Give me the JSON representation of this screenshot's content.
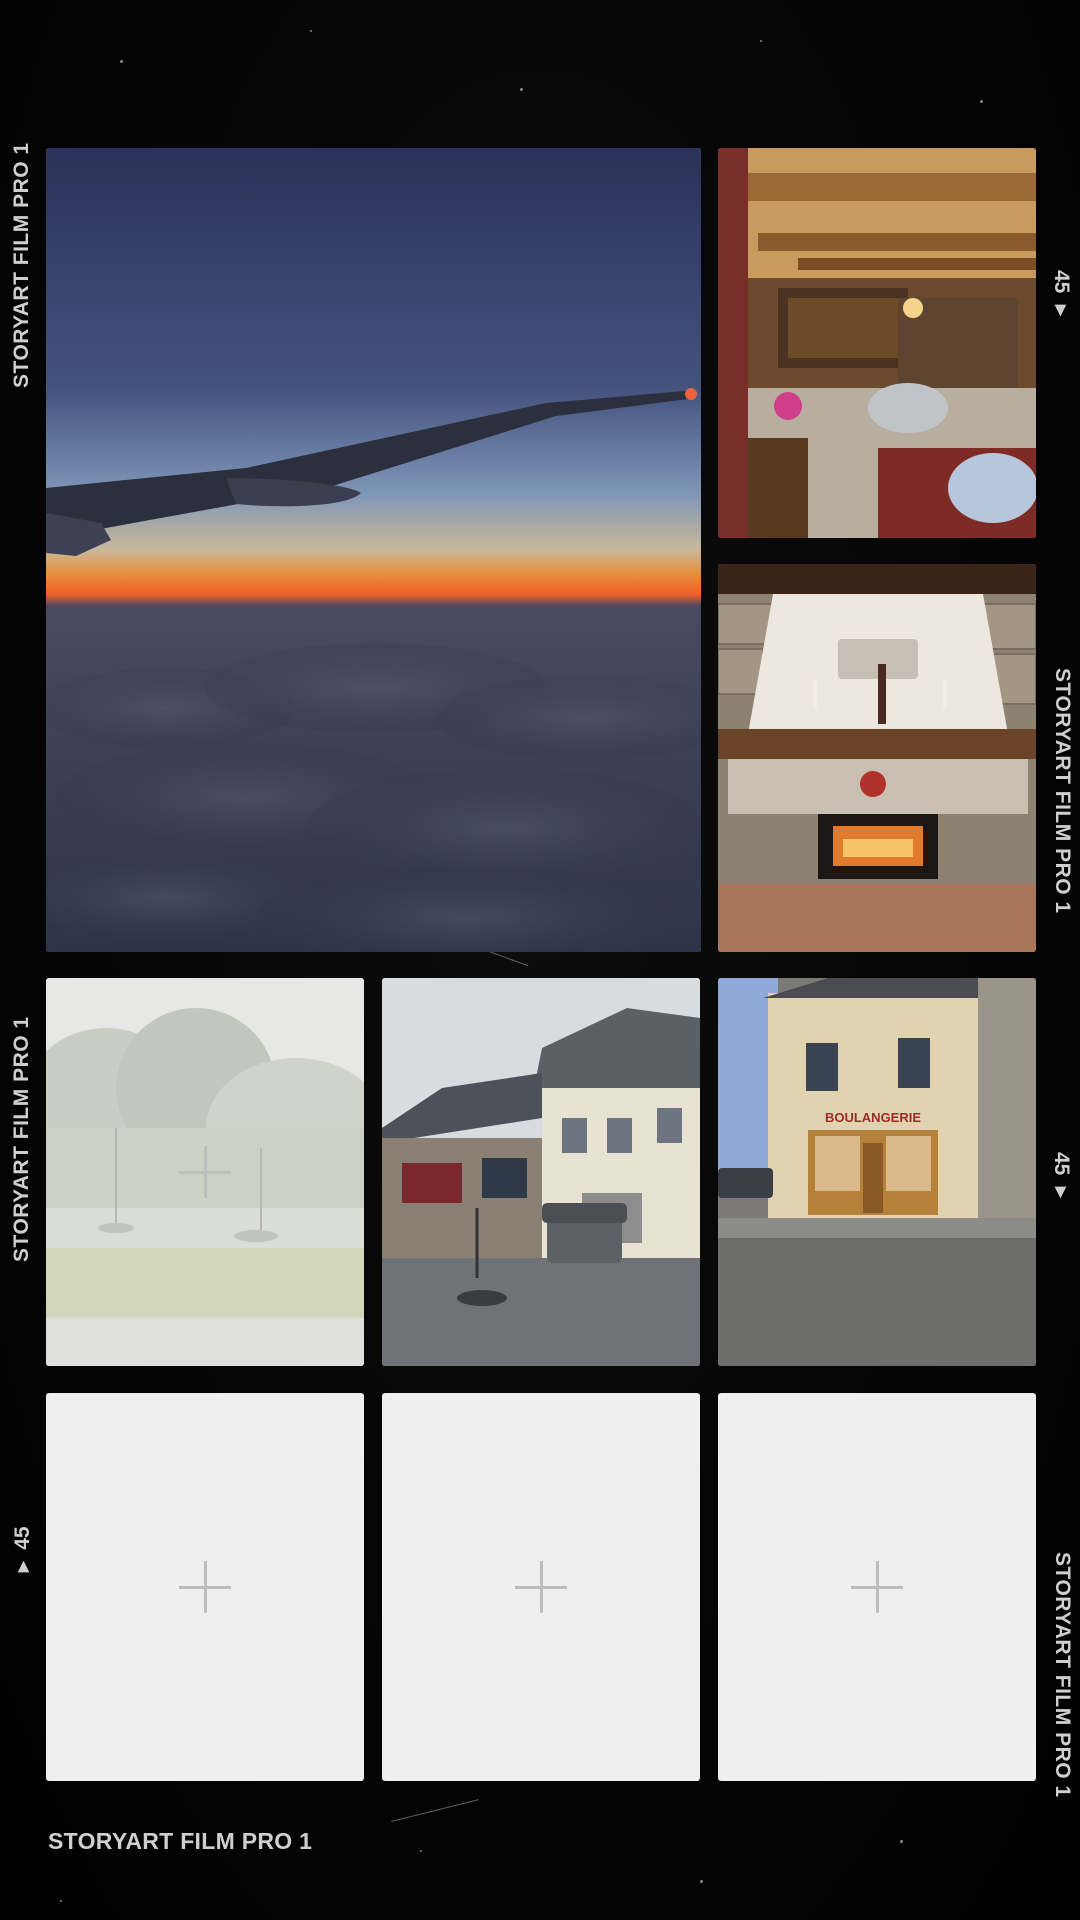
{
  "film_brand": "STORYART FILM PRO 1",
  "frame_number": "45",
  "frame_marker": "▸",
  "bottom_label": "STORYART FILM PRO 1",
  "empty_slot_icon": "plus-icon",
  "slots": [
    {
      "id": "airplane-wing-sunset",
      "state": "filled"
    },
    {
      "id": "timber-beam-living-room",
      "state": "filled"
    },
    {
      "id": "stone-fireplace",
      "state": "filled"
    },
    {
      "id": "foggy-harbor-boats",
      "state": "faded-with-add"
    },
    {
      "id": "rainy-village-street",
      "state": "filled"
    },
    {
      "id": "boulangerie-shopfront",
      "state": "filled",
      "sign_text": "BOULANGERIE"
    },
    {
      "id": "empty-slot-1",
      "state": "empty"
    },
    {
      "id": "empty-slot-2",
      "state": "empty"
    },
    {
      "id": "empty-slot-3",
      "state": "empty"
    }
  ]
}
